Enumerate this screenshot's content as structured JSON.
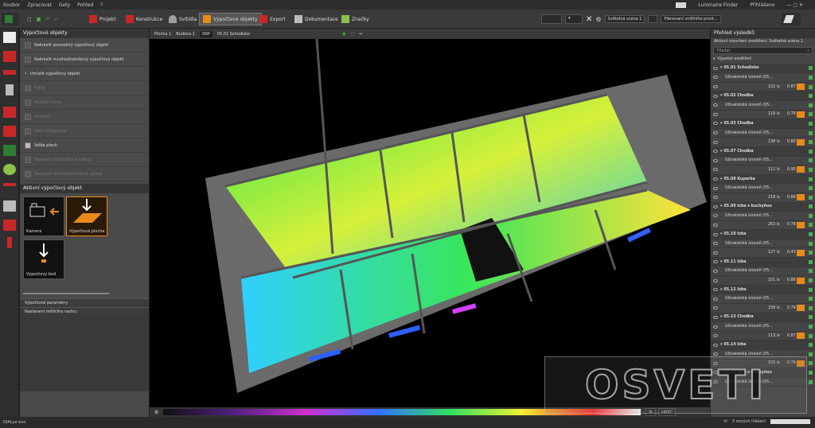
{
  "menu": {
    "items": [
      "Soubor",
      "Zpracovat",
      "Gety",
      "Pohled",
      "?"
    ],
    "finder": "Luminaire Finder",
    "login": "Přihlášeno",
    "logo": "Dx"
  },
  "ribbon": {
    "tabs": [
      "Projekt",
      "Konstrukce",
      "Svítidla",
      "Výpočtové objekty",
      "Export",
      "Dokumentace",
      "Značky"
    ],
    "active": 3,
    "light_scene": "Světelná scéna 1",
    "time_profile": "Plánovaní vnitřního prost..."
  },
  "leftpanel": {
    "title": "Výpočtové objekty",
    "items": [
      {
        "label": "Nakreslit pravoúhlý výpočtový objekt",
        "disabled": false
      },
      {
        "label": "Nakreslit mnohoúhelníkový výpočtový objekt",
        "disabled": false
      },
      {
        "label": "Umístit výpočtový objekt",
        "disabled": false
      },
      {
        "label": "Kolize",
        "disabled": true
      },
      {
        "label": "Rozšířit hranu",
        "disabled": true
      },
      {
        "label": "Hraniční",
        "disabled": true
      },
      {
        "label": "Dělicí diagonála",
        "disabled": true
      },
      {
        "label": "Volba ploch",
        "disabled": false
      },
      {
        "label": "Nakreslit obdélníkové výřezy",
        "disabled": true
      },
      {
        "label": "Nakreslit mnohoúhelníkové výřezy",
        "disabled": true
      }
    ],
    "active_title": "Aktivní výpočtový objekt",
    "thumbs": [
      "Kamera",
      "Výpočtová plocha",
      "Výpočtový bod"
    ],
    "sections": [
      "Výpočtové parametry",
      "Nastavení měřicího rastru"
    ]
  },
  "viewport": {
    "breadcrumb": [
      "Plocha 1",
      "Budova 1",
      "SNP",
      "05.01 Schodisko"
    ]
  },
  "scale": {
    "labels": [
      "0.10",
      "0.25",
      "0.63",
      "1.58",
      "3.98",
      "10",
      "15.8",
      "25.1",
      "39.8",
      "63.1",
      "100",
      "158",
      "251",
      "398",
      "631",
      "1000",
      "1580",
      "2510",
      "3980",
      "6310",
      "10000",
      "15800"
    ],
    "unit": "lx",
    "unit2": "cd/m²"
  },
  "results": {
    "title": "Přehled výsledků",
    "subtitle": "Aktivní rozvržení osvětlení: Světelná scéna 1",
    "search_placeholder": "Hledat",
    "group": "Výpočet osvětlení",
    "rooms": [
      {
        "name": "05.01 Schodisko",
        "lx": "132 lx",
        "u": "0.87"
      },
      {
        "name": "05.02 Chodba",
        "lx": "119 lx",
        "u": "0.76"
      },
      {
        "name": "05.03 Chodba",
        "lx": "138 lx",
        "u": "0.80"
      },
      {
        "name": "05.07 Chodba",
        "lx": "112 lx",
        "u": "0.90"
      },
      {
        "name": "05.08 Kuperka",
        "lx": "218 lx",
        "u": "0.89"
      },
      {
        "name": "05.09 Izba s kuchyňou",
        "lx": "263 lx",
        "u": "0.78"
      },
      {
        "name": "05.10 Izba",
        "lx": "127 lx",
        "u": "0.43"
      },
      {
        "name": "05.11 Izba",
        "lx": "151 lx",
        "u": "0.86"
      },
      {
        "name": "05.12 Izba",
        "lx": "158 lx",
        "u": "0.79"
      },
      {
        "name": "05.13 Chodba",
        "lx": "113 lx",
        "u": "0.87"
      },
      {
        "name": "05.14 Izba",
        "lx": "150 lx",
        "u": "0.76"
      },
      {
        "name": "05.15 Izba s kuchyňou",
        "lx": "",
        "u": ""
      }
    ],
    "sub_label": "Uživatelská úroveň (05..."
  },
  "status": {
    "left": "DIALux evo",
    "right": "3 nových hlášení"
  },
  "watermark": "OSVETI",
  "colors": {
    "accent": "#e88a1a",
    "ok": "#4caf50"
  }
}
